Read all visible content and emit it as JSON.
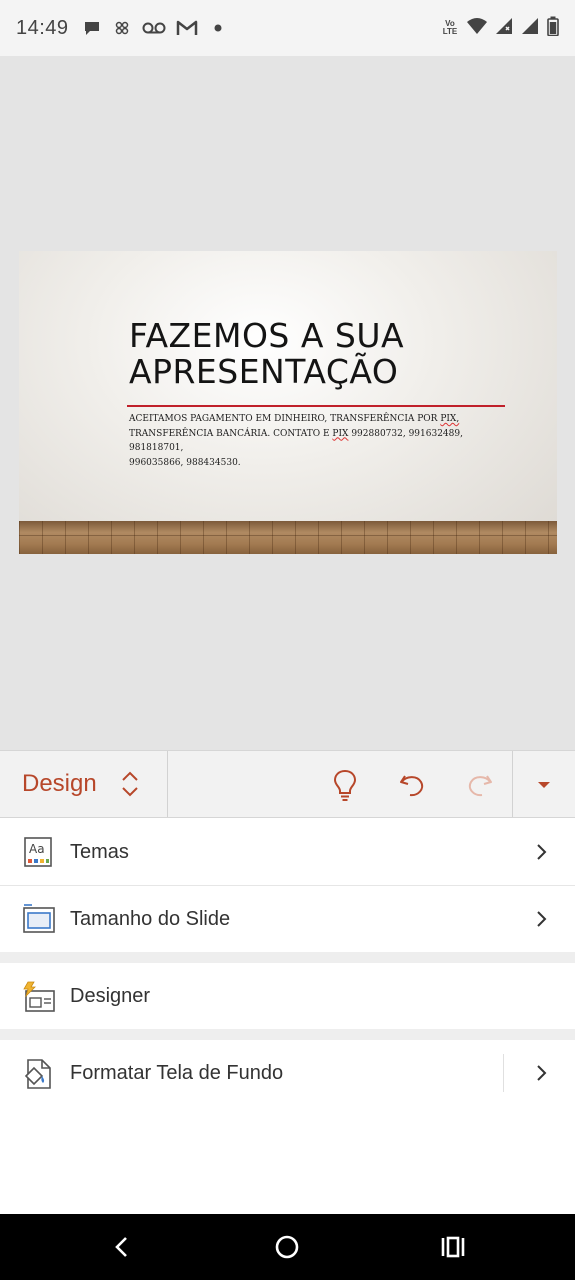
{
  "status_bar": {
    "time": "14:49",
    "notification_icons": [
      "chat-bubble-icon",
      "app-icon",
      "voicemail-icon",
      "gmail-icon",
      "dot-icon"
    ],
    "network_label_top": "Vo",
    "network_label_bottom": "LTE",
    "status_icons": [
      "wifi-icon",
      "signal-icon",
      "signal-icon",
      "battery-icon"
    ]
  },
  "slide": {
    "title_line1": "FAZEMOS A SUA",
    "title_line2": "APRESENTAÇÃO",
    "subtitle_line1_a": "ACEITAMOS PAGAMENTO EM DINHEIRO, TRANSFERÊNCIA POR ",
    "subtitle_line1_b": "PIX,",
    "subtitle_line2_a": "TRANSFERÊNCIA BANCÁRIA. CONTATO E ",
    "subtitle_line2_b": "PIX",
    "subtitle_line2_c": " 992880732, 991632489, 981818701,",
    "subtitle_line3": "996035866, 988434530.",
    "accent_color": "#c0202a"
  },
  "toolbar": {
    "tab_label": "Design",
    "accent_color": "#b7472a",
    "buttons": [
      "lightbulb-icon",
      "undo-icon",
      "redo-icon",
      "dropdown-arrow-icon"
    ]
  },
  "menu": {
    "items": [
      {
        "label": "Temas",
        "icon": "themes-icon",
        "has_chevron": true
      },
      {
        "label": "Tamanho do Slide",
        "icon": "slide-size-icon",
        "has_chevron": true
      },
      {
        "label": "Designer",
        "icon": "designer-icon",
        "has_chevron": false
      },
      {
        "label": "Formatar Tela de Fundo",
        "icon": "format-background-icon",
        "has_chevron": true
      }
    ]
  },
  "nav_bar": {
    "buttons": [
      "back-icon",
      "home-icon",
      "recents-icon"
    ]
  }
}
